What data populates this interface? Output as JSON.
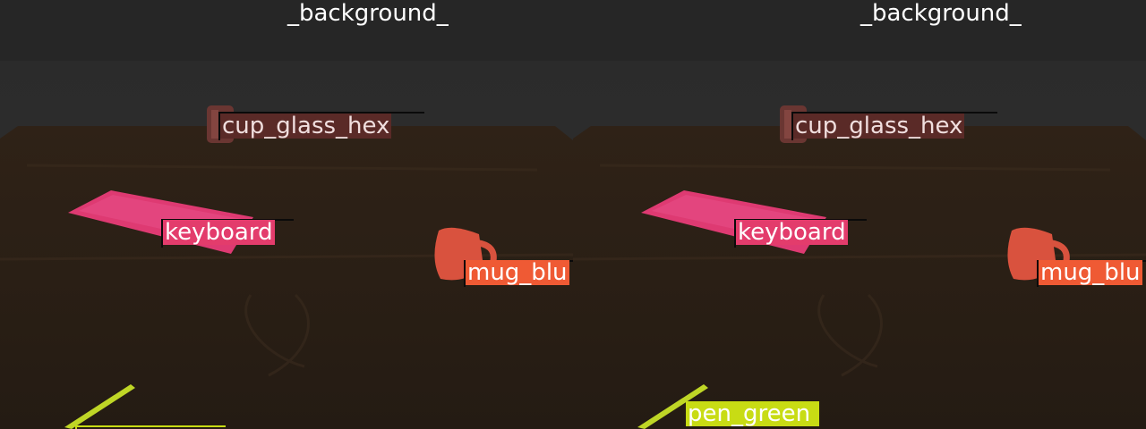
{
  "panels": [
    {
      "background_label": "_background_",
      "labels": {
        "cup": "cup_glass_hex",
        "keyboard": "keyboard",
        "mug": "mug_blu"
      },
      "colors": {
        "cup": "#5a2a27",
        "keyboard": "#e33c6c",
        "mug": "#ef5a34",
        "pen": "#c8dc14"
      }
    },
    {
      "background_label": "_background_",
      "labels": {
        "cup": "cup_glass_hex",
        "keyboard": "keyboard",
        "mug": "mug_blu",
        "pen": "pen_green"
      },
      "colors": {
        "cup": "#5a2a27",
        "keyboard": "#e33c6c",
        "mug": "#ef5a34",
        "pen": "#c8dc14"
      }
    }
  ]
}
